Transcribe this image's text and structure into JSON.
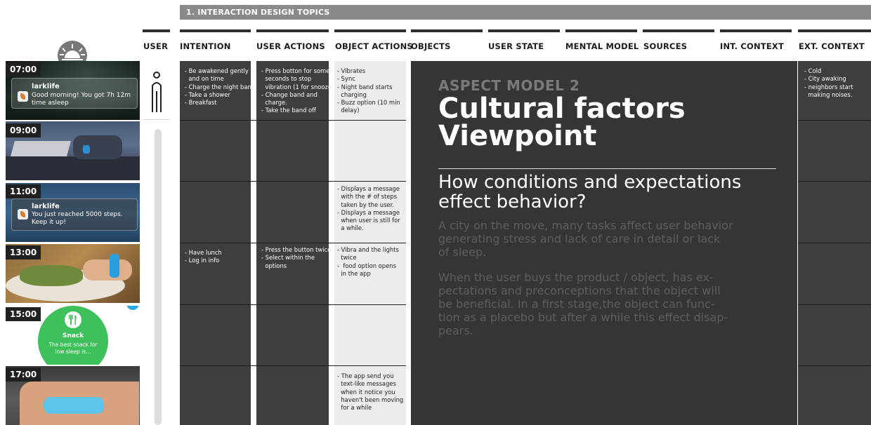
{
  "section_title": "1. INTERACTION DESIGN TOPICS",
  "columns": [
    "USER",
    "INTENTION",
    "USER ACTIONS",
    "OBJECT ACTIONS",
    "OBJECTS",
    "USER STATE",
    "MENTAL MODEL",
    "SOURCES",
    "INT. CONTEXT",
    "EXT. CONTEXT"
  ],
  "timeline": [
    {
      "time": "07:00",
      "notif_app": "larklife",
      "notif_text": "Good morning! You got 7h 12m time asleep"
    },
    {
      "time": "09:00"
    },
    {
      "time": "11:00",
      "notif_app": "larklife",
      "notif_text": "You just reached 5000 steps. Keep it up!"
    },
    {
      "time": "13:00"
    },
    {
      "time": "15:00",
      "snack_title": "Snack",
      "snack_text": "The best snack for low sleep is..."
    },
    {
      "time": "17:00"
    }
  ],
  "intention": [
    "- Be awakened gently\n  and on time\n- Charge the night band\n- Take a shower\n- Breakfast",
    "",
    "",
    "- Have lunch\n- Log in info",
    "",
    ""
  ],
  "user_actions": [
    "- Press botton for some\n  seconds to stop\n  vibration (1 for snooze)\n- Change band and\n  charge.\n- Take the band off",
    "",
    "",
    "- Press the button twice\n- Select within the\n  options",
    "",
    ""
  ],
  "object_actions": [
    "- Vibrates\n- Sync\n- Night band starts\n  charging\n- Buzz option (10 min\n  delay)",
    "",
    "- Displays a message\n  with the # of steps\n  taken by the user.\n- Displays a message\n  when user is still for\n  a while.",
    "- Vibra and the lights\n  twice\n-  food option opens\n  in the app",
    "",
    "- The app send you\n  text-like messages\n  when it notice you\n  haven't been moving\n  for a while"
  ],
  "ext_context": [
    "- Cold\n- City awaking\n- neighbors start\n  making noises.",
    "",
    "",
    "",
    "",
    ""
  ],
  "aspect_label": "ASPECT MODEL 2",
  "main_title": "Cultural factors\nViewpoint",
  "subtitle": "How conditions and expectations\neffect behavior?",
  "paragraph1": "A city on the move, many tasks affect user behavior\ngenerating stress and lack of care in detail or lack\nof sleep.",
  "paragraph2": "When the user buys the product / object, has ex-\npectations and preconceptions that the object will\nbe beneficial. In a first stage,the object can func-\ntion as a placebo but after a while this effect disap-\npears.",
  "colors": {
    "dark_col": "#3e3e3e",
    "panel": "#353535",
    "light_col": "#ececec",
    "header_bar": "#8a8a8a",
    "snack_green": "#3ec15a"
  },
  "icons": [
    "sunrise-icon",
    "user-figure-icon",
    "larklife-app-icon",
    "fork-knife-icon"
  ]
}
